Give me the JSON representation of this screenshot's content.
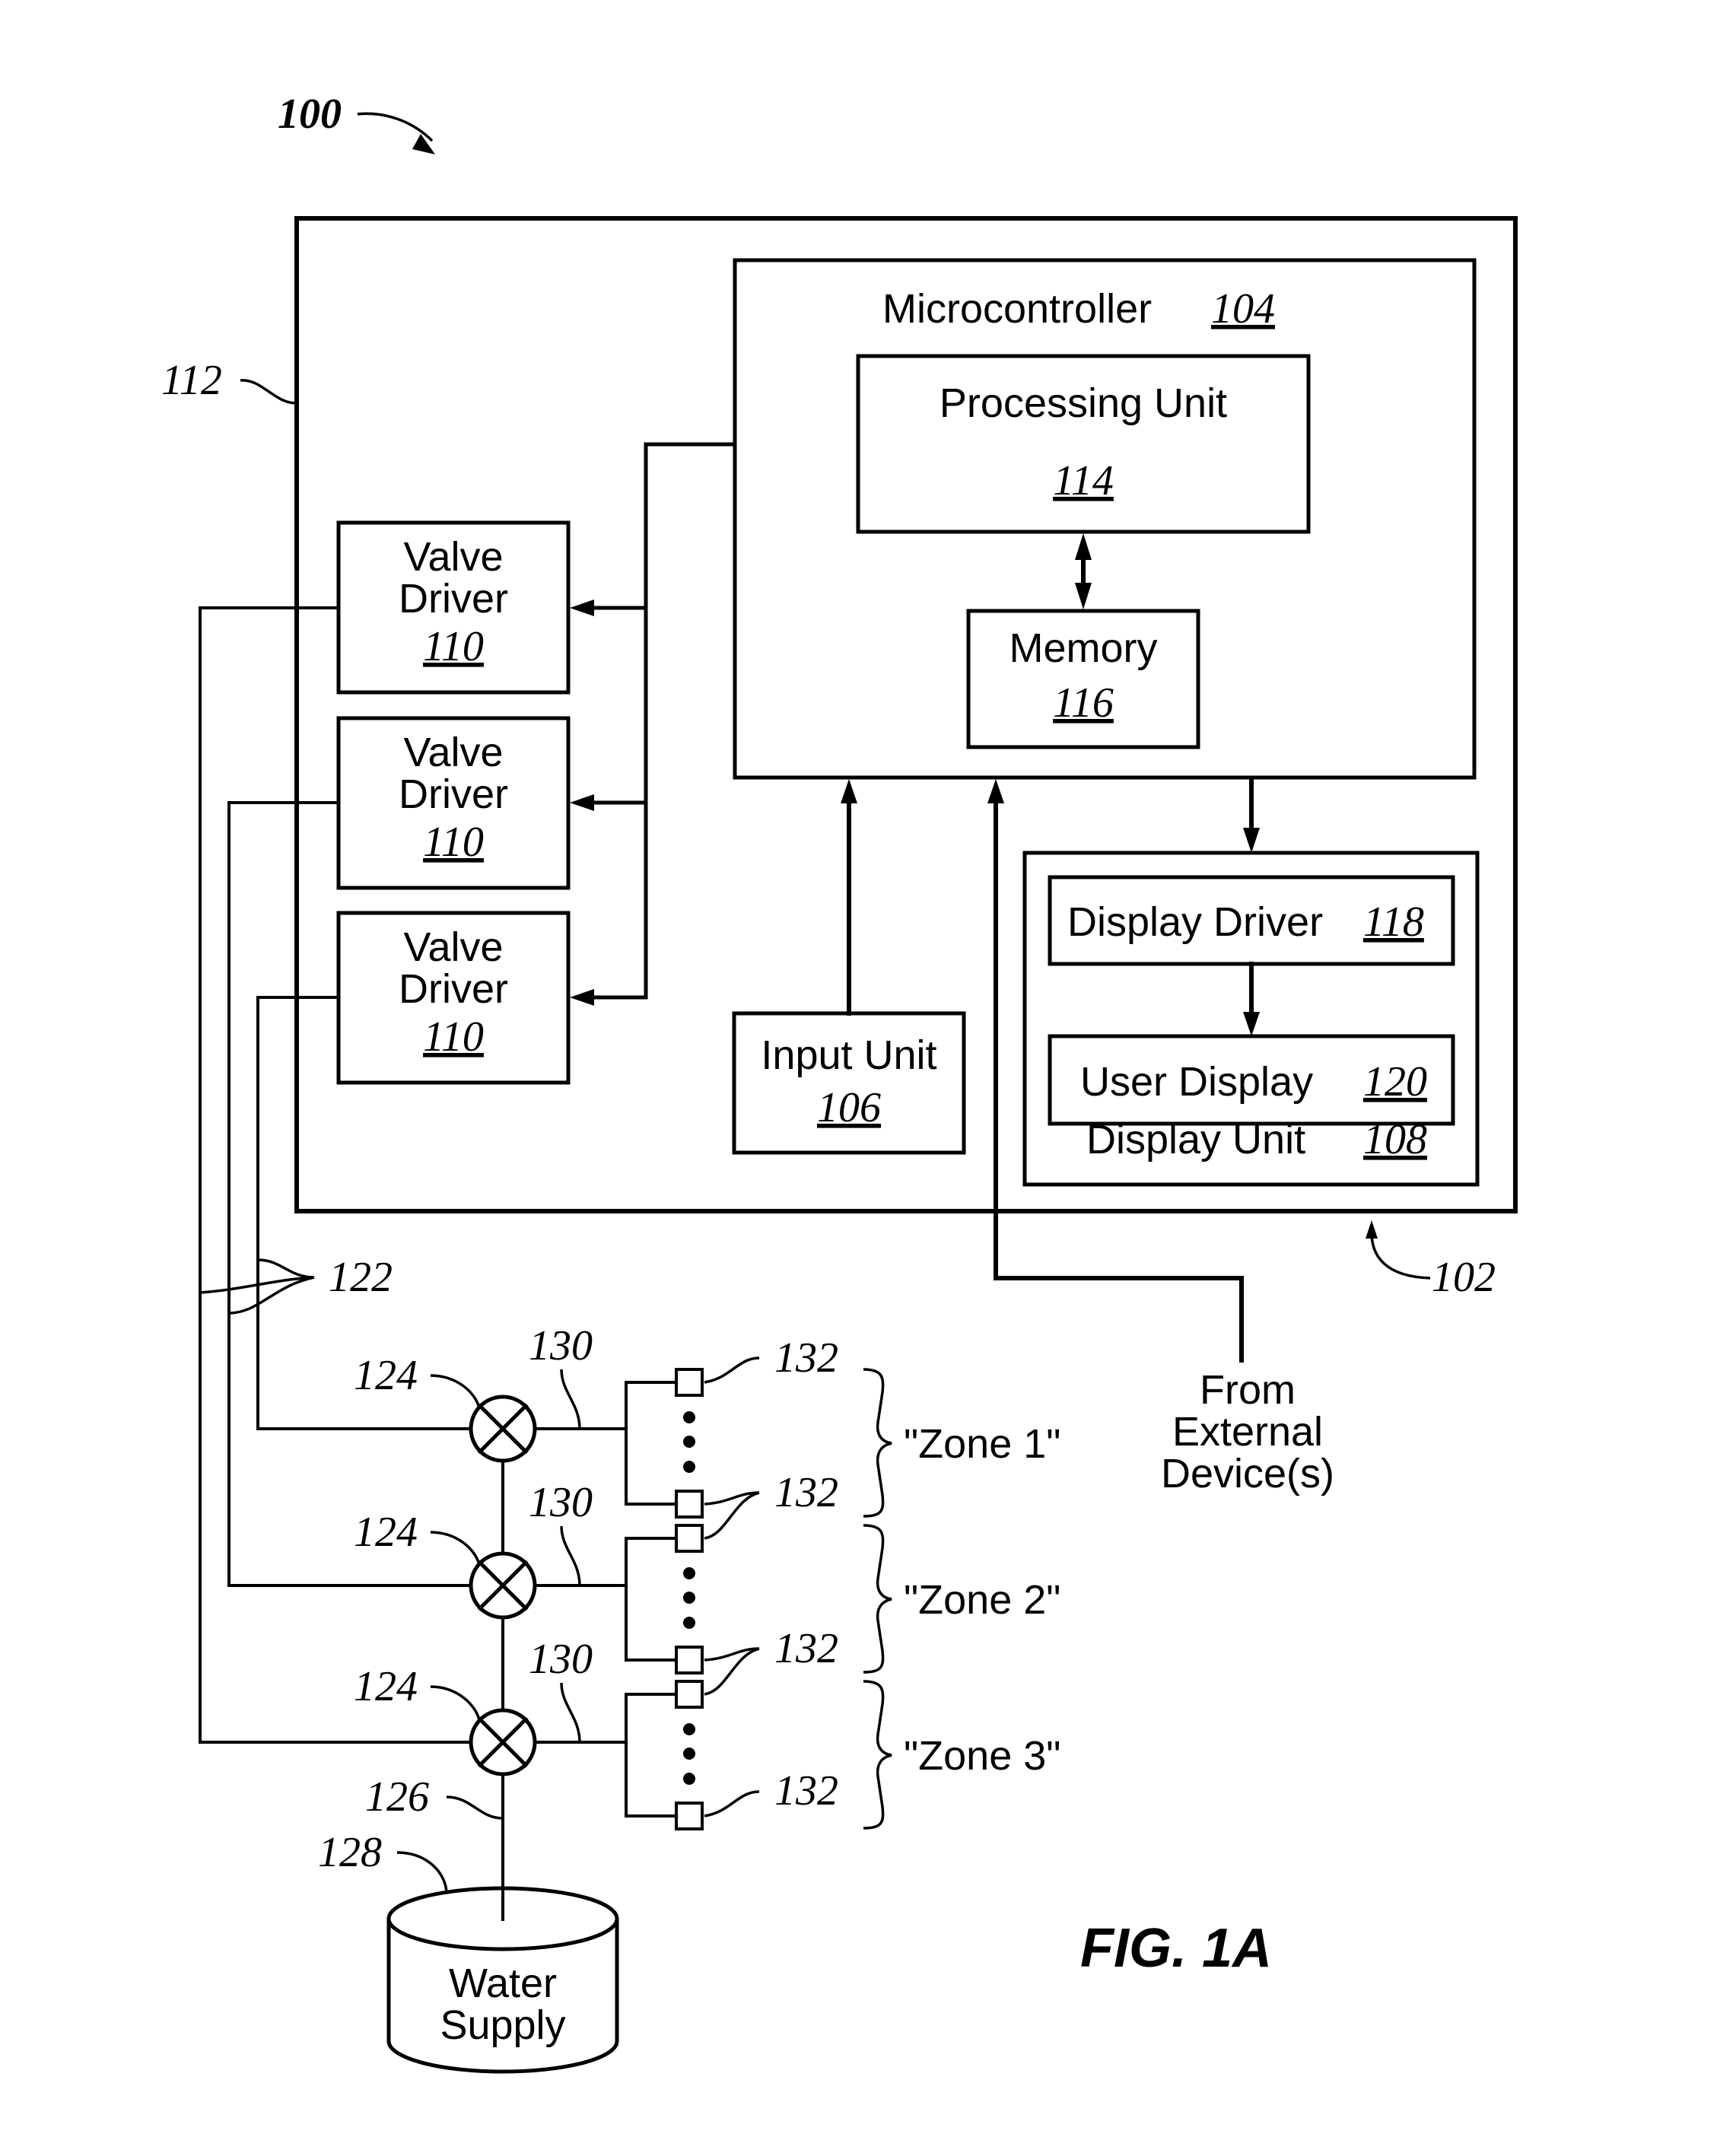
{
  "figure": {
    "title": "FIG. 1A",
    "system_ref": "100",
    "controller_ref": "102",
    "housing_ref": "112"
  },
  "microcontroller": {
    "label": "Microcontroller",
    "ref": "104"
  },
  "processing_unit": {
    "label": "Processing Unit",
    "ref": "114"
  },
  "memory": {
    "label": "Memory",
    "ref": "116"
  },
  "input_unit": {
    "label": "Input Unit",
    "ref": "106"
  },
  "display_unit": {
    "label": "Display Unit",
    "ref": "108"
  },
  "display_driver": {
    "label": "Display Driver",
    "ref": "118"
  },
  "user_display": {
    "label": "User Display",
    "ref": "120"
  },
  "valve_drivers": [
    {
      "line1": "Valve",
      "line2": "Driver",
      "ref": "110"
    },
    {
      "line1": "Valve",
      "line2": "Driver",
      "ref": "110"
    },
    {
      "line1": "Valve",
      "line2": "Driver",
      "ref": "110"
    }
  ],
  "external": {
    "line1": "From",
    "line2": "External",
    "line3": "Device(s)"
  },
  "wires_ref": "122",
  "valves": [
    {
      "ref": "124",
      "pipe_ref": "130"
    },
    {
      "ref": "124",
      "pipe_ref": "130"
    },
    {
      "ref": "124",
      "pipe_ref": "130"
    }
  ],
  "zones": [
    {
      "label": "\"Zone 1\"",
      "sprinkler_ref_top": "132",
      "sprinkler_ref_bottom": "132"
    },
    {
      "label": "\"Zone 2\"",
      "sprinkler_ref_top": "",
      "sprinkler_ref_bottom": "132"
    },
    {
      "label": "\"Zone 3\"",
      "sprinkler_ref_top": "",
      "sprinkler_ref_bottom": "132"
    }
  ],
  "main_pipe_ref": "126",
  "water_supply": {
    "ref": "128",
    "line1": "Water",
    "line2": "Supply"
  }
}
